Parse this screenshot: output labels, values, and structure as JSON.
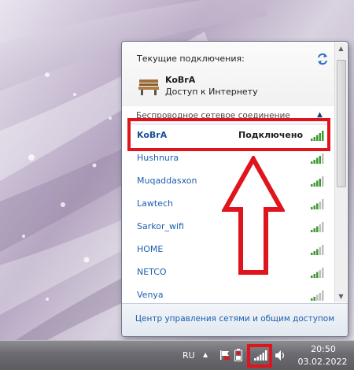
{
  "flyout": {
    "current_title": "Текущие подключения:",
    "current_network": {
      "name": "KoBrA",
      "status": "Доступ к Интернету",
      "icon": "bench-icon"
    },
    "section_label": "Беспроводное сетевое соединение",
    "networks": [
      {
        "name": "KoBrA",
        "state": "Подключено",
        "connected": true
      },
      {
        "name": "Hushnura",
        "state": "",
        "connected": false
      },
      {
        "name": "Muqaddasxon",
        "state": "",
        "connected": false
      },
      {
        "name": "Lawtech",
        "state": "",
        "connected": false
      },
      {
        "name": "Sarkor_wifi",
        "state": "",
        "connected": false
      },
      {
        "name": "HOME",
        "state": "",
        "connected": false
      },
      {
        "name": "NETCO",
        "state": "",
        "connected": false
      },
      {
        "name": "Venya",
        "state": "",
        "connected": false
      }
    ],
    "footer_link": "Центр управления сетями и общим доступом"
  },
  "taskbar": {
    "language": "RU",
    "time": "20:50",
    "date": "03.02.2022"
  },
  "colors": {
    "annotation_red": "#e0141c",
    "link_blue": "#1c5fb0",
    "signal_green": "#3c9a2e"
  }
}
